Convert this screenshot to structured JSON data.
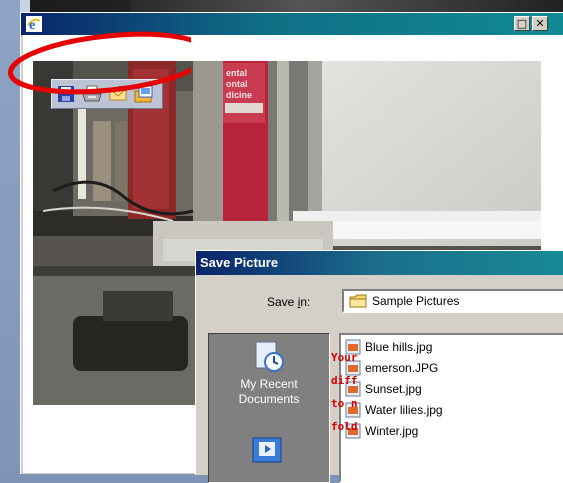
{
  "window": {
    "icon": "ie-icon",
    "maximize_glyph": "□",
    "close_glyph": "✕"
  },
  "image_toolbar": {
    "buttons": [
      {
        "name": "save-icon"
      },
      {
        "name": "print-icon"
      },
      {
        "name": "email-icon"
      },
      {
        "name": "my-pictures-icon"
      }
    ]
  },
  "save_dialog": {
    "title": "Save Picture",
    "save_in_label": "Save in:",
    "save_in_value": "Sample Pictures",
    "places": [
      {
        "label_line1": "My Recent",
        "label_line2": "Documents",
        "icon": "recent-documents-icon"
      },
      {
        "icon": "desktop-icon"
      }
    ],
    "files": [
      {
        "name": "Blue hills.jpg"
      },
      {
        "name": "emerson.JPG"
      },
      {
        "name": "Sunset.jpg"
      },
      {
        "name": "Water lilies.jpg"
      },
      {
        "name": "Winter.jpg"
      }
    ]
  },
  "annotation_note": {
    "lines": [
      "Your",
      "diff",
      "to n",
      "fold"
    ],
    "color": "#d40000"
  },
  "colors": {
    "title_start": "#0a246a",
    "title_end": "#108a95",
    "highlight_ring": "#e60000",
    "face": "#d4d0c8"
  }
}
